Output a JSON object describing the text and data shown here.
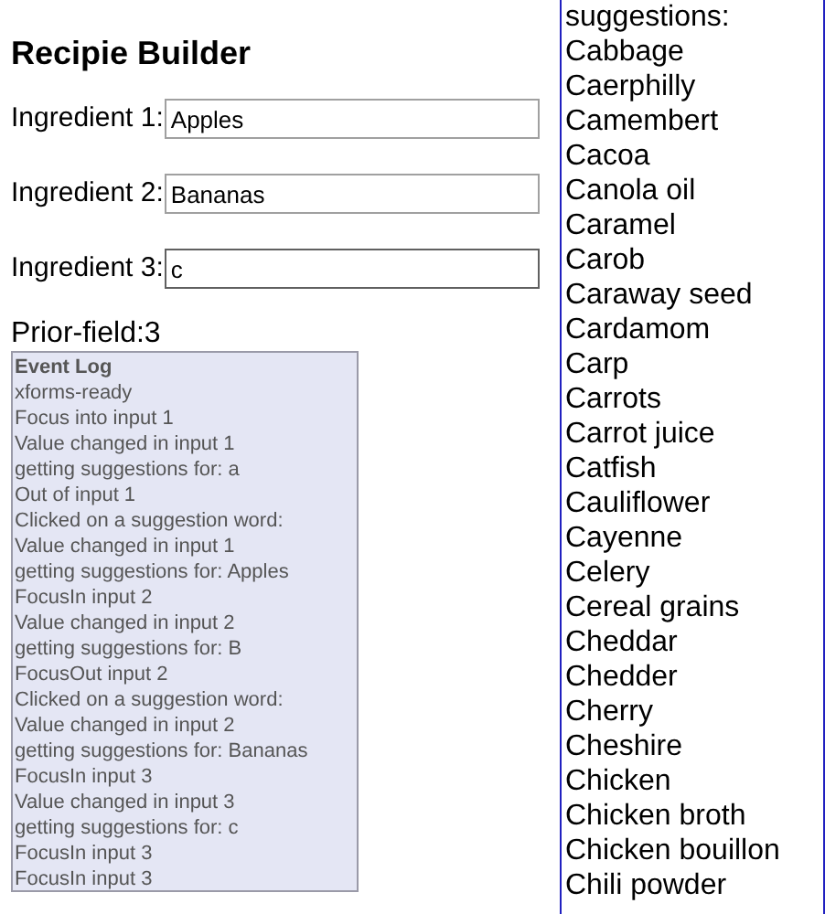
{
  "title": "Recipie Builder",
  "ingredients": [
    {
      "label": "Ingredient 1:",
      "value": "Apples",
      "focused": false
    },
    {
      "label": "Ingredient 2:",
      "value": "Bananas",
      "focused": false
    },
    {
      "label": "Ingredient 3:",
      "value": "c",
      "focused": true
    }
  ],
  "prior_field": "Prior-field:3",
  "event_log": {
    "heading": "Event Log",
    "entries": [
      "xforms-ready",
      "Focus into input 1",
      "Value changed in input 1",
      "getting suggestions for: a",
      "Out of input 1",
      "Clicked on a suggestion word:",
      "Value changed in input 1",
      "getting suggestions for: Apples",
      "FocusIn input 2",
      "Value changed in input 2",
      "getting suggestions for: B",
      "FocusOut input 2",
      "Clicked on a suggestion word:",
      "Value changed in input 2",
      "getting suggestions for: Bananas",
      "FocusIn input 3",
      "Value changed in input 3",
      "getting suggestions for: c",
      "FocusIn input 3",
      "FocusIn input 3"
    ]
  },
  "suggestions": {
    "heading": "suggestions:",
    "items": [
      "Cabbage",
      "Caerphilly",
      "Camembert",
      "Cacoa",
      "Canola oil",
      "Caramel",
      "Carob",
      "Caraway seed",
      "Cardamom",
      "Carp",
      "Carrots",
      "Carrot juice",
      "Catfish",
      "Cauliflower",
      "Cayenne",
      "Celery",
      "Cereal grains",
      "Cheddar",
      "Chedder",
      "Cherry",
      "Cheshire",
      "Chicken",
      "Chicken broth",
      "Chicken bouillon",
      "Chili powder"
    ]
  }
}
